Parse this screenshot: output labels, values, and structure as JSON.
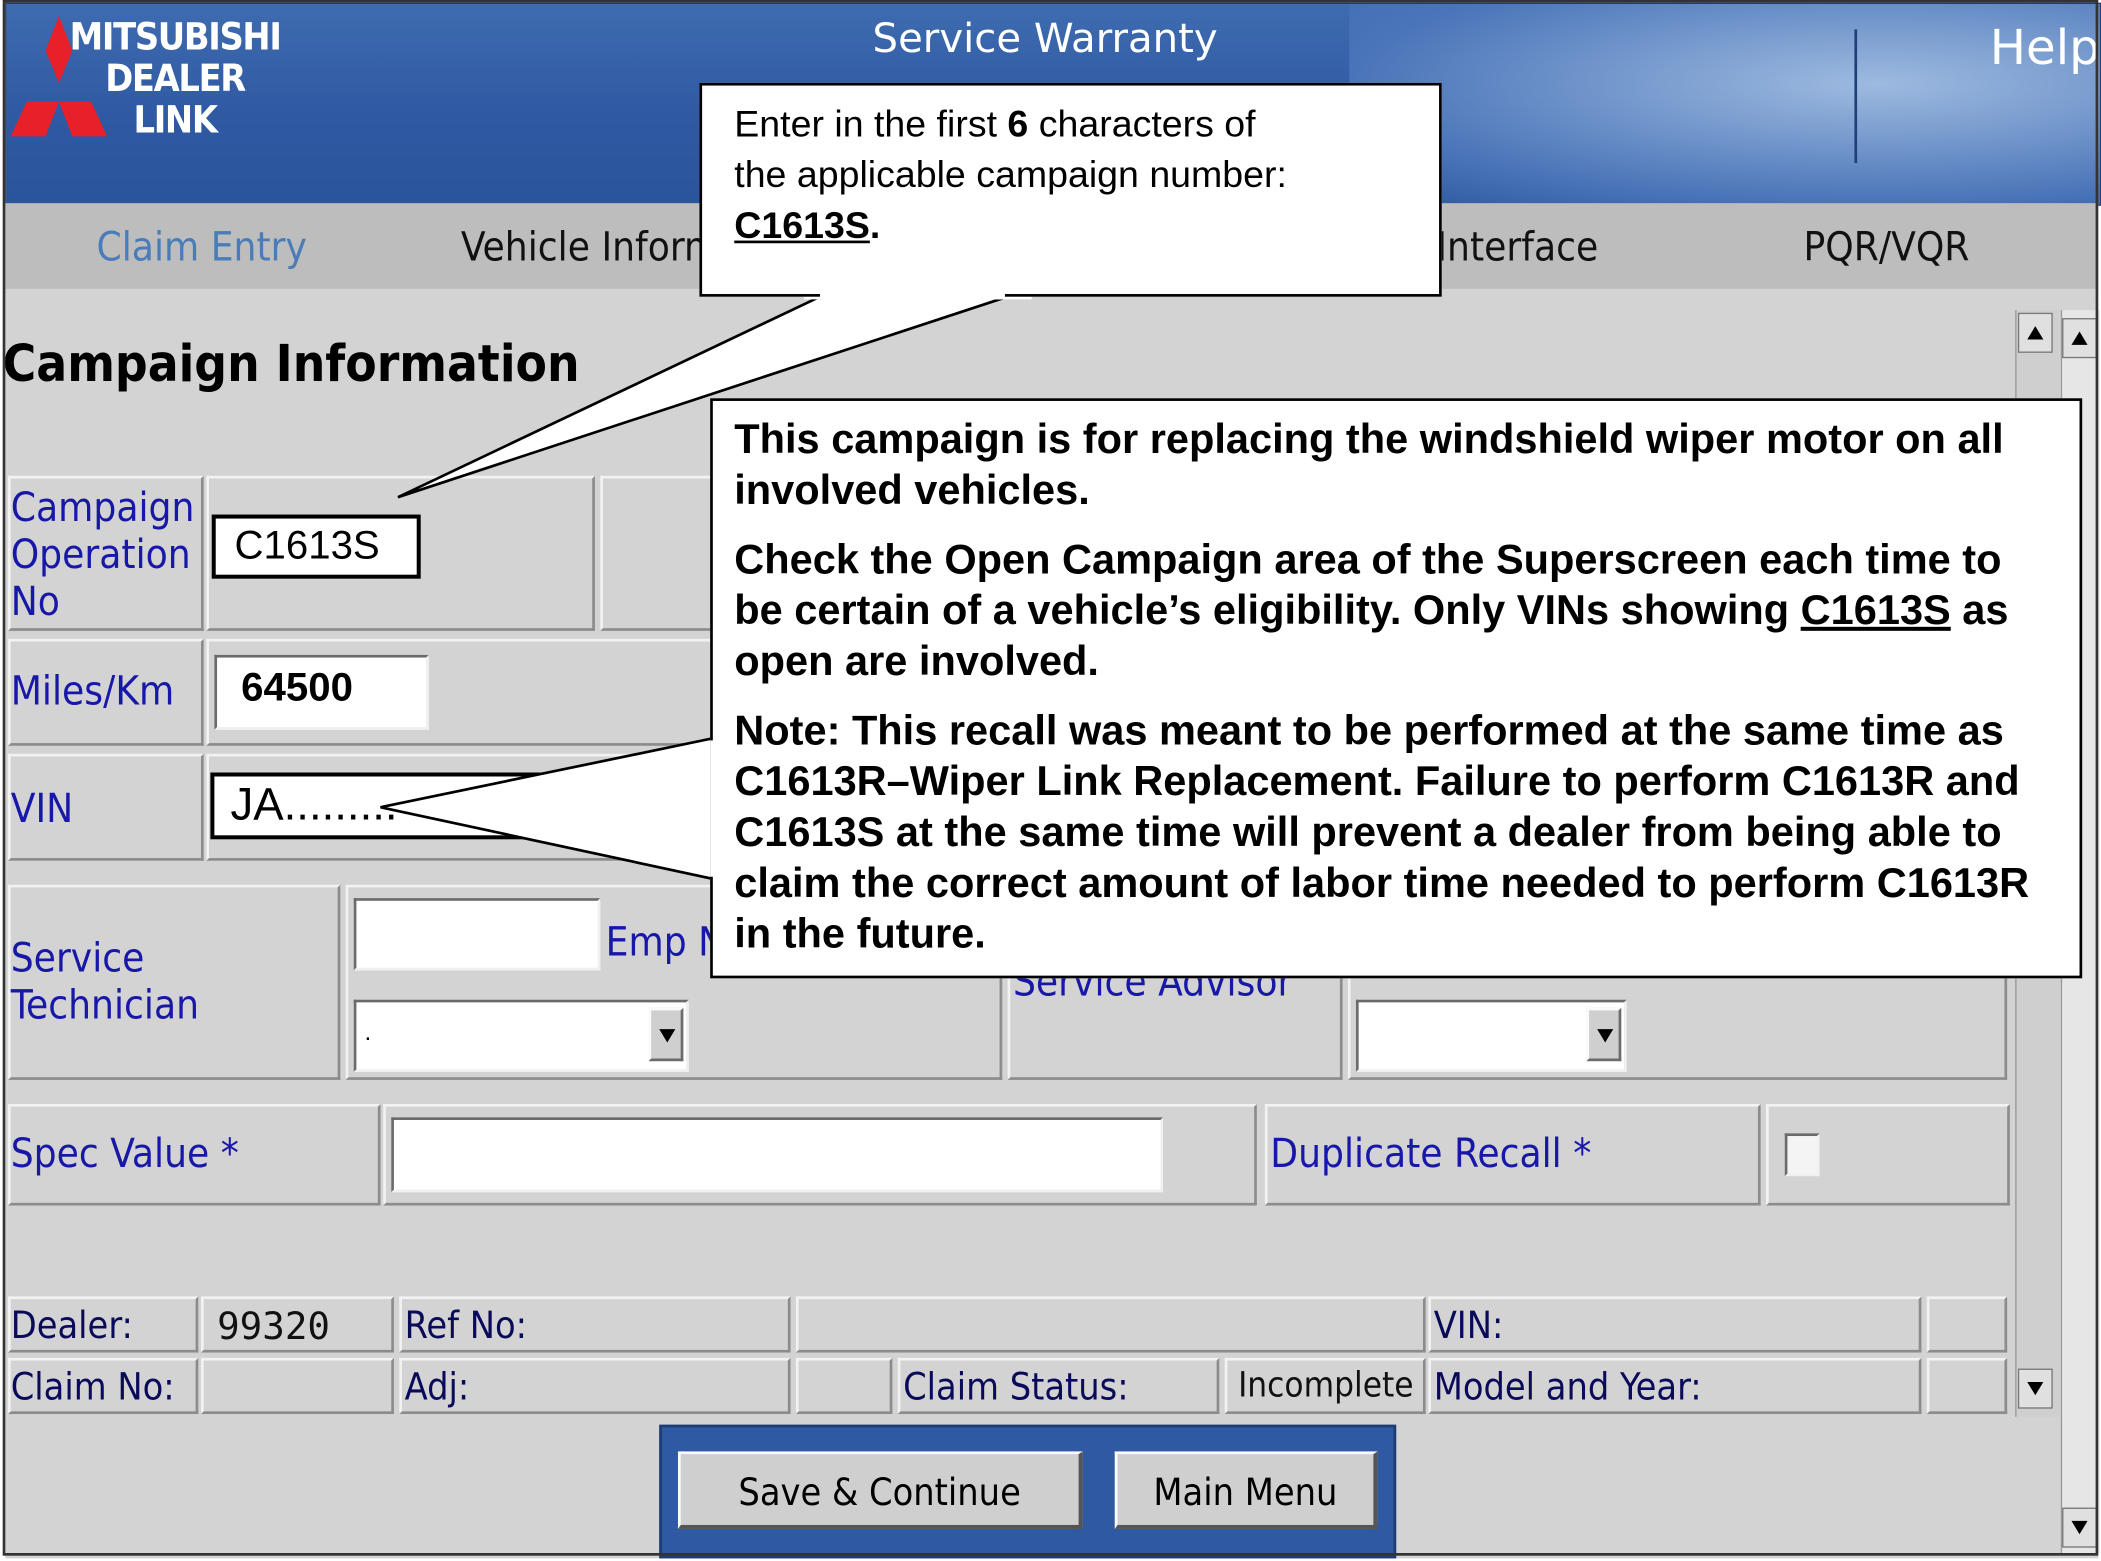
{
  "header": {
    "logo_text": "MITSUBISHI\nDEALER\nLINK",
    "title": "Service Warranty",
    "help_label": "Help"
  },
  "nav": {
    "items": [
      "Claim Entry",
      "Vehicle Inform",
      "Interface",
      "PQR/VQR"
    ]
  },
  "section": {
    "title": "Campaign Information"
  },
  "form": {
    "campaign_operation_no_label": "Campaign\nOperation\nNo",
    "campaign_operation_no_value": "C1613S",
    "miles_label": "Miles/Km",
    "miles_value": "64500",
    "vin_label": "VIN",
    "vin_value": "JA.........",
    "service_technician_label": "Service\nTechnician",
    "emp_label": "Emp N",
    "technician_select_value": ".",
    "service_advisor_label": "Service Advisor",
    "spec_value_label": "Spec Value *",
    "duplicate_recall_label": "Duplicate Recall *"
  },
  "footer": {
    "dealer_label": "Dealer:",
    "dealer_value": "99320",
    "ref_no_label": "Ref No:",
    "vin_label": "VIN:",
    "claim_no_label": "Claim No:",
    "adj_label": "Adj:",
    "claim_status_label": "Claim Status:",
    "claim_status_value": "Incomplete",
    "model_year_label": "Model and Year:"
  },
  "buttons": {
    "save_continue": "Save & Continue",
    "main_menu": "Main Menu"
  },
  "callouts": {
    "top": {
      "line1_a": "Enter in the first ",
      "line1_b": "6",
      "line1_c": " characters of",
      "line2": "the applicable campaign number:",
      "code": "C1613S",
      "period": "."
    },
    "main": {
      "p1": "This campaign is for replacing the windshield wiper motor on all involved vehicles.",
      "p2_a": "Check the Open Campaign area of the Superscreen each time to be certain of a vehicle’s eligibility. Only VINs showing ",
      "p2_code": "C1613S",
      "p2_b": " as open are involved.",
      "p3": "Note: This recall was meant to be performed at the same time as C1613R–Wiper Link Replacement. Failure to perform C1613R and C1613S at the same time will prevent a dealer from being able to claim the correct amount of labor time needed to perform C1613R in the future."
    }
  },
  "colors": {
    "header_blue": "#2f5aa3",
    "nav_gray": "#bdbdbd",
    "panel_gray": "#d3d3d3",
    "label_blue": "#1717a8",
    "logo_red": "#e8202a"
  }
}
